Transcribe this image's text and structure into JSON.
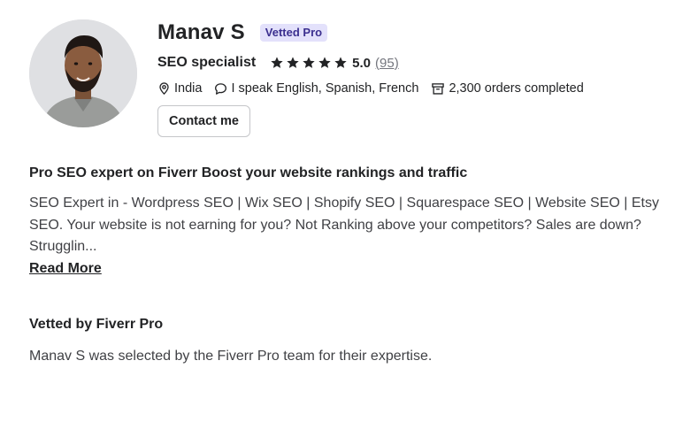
{
  "profile": {
    "name": "Manav S",
    "badge": "Vetted Pro",
    "title": "SEO specialist",
    "rating": "5.0",
    "reviews": "(95)",
    "star_count": 5,
    "star_color": "#222325",
    "location": "India",
    "languages": "I speak English, Spanish, French",
    "orders": "2,300 orders completed",
    "contact_label": "Contact me"
  },
  "about": {
    "headline": "Pro SEO expert on Fiverr Boost your website rankings and traffic",
    "description": "SEO Expert in - Wordpress SEO | Wix SEO | Shopify SEO | Squarespace SEO | Website SEO | Etsy SEO. Your website is not earning for you? Not Ranking above your competitors? Sales are down? Strugglin...",
    "read_more": "Read More"
  },
  "vetted": {
    "title": "Vetted by Fiverr Pro",
    "text": "Manav S was selected by the Fiverr Pro team for their expertise."
  },
  "colors": {
    "badge_bg": "#e3e1fb",
    "badge_text": "#3b2f8f",
    "text_primary": "#222325",
    "text_secondary": "#74767e"
  }
}
